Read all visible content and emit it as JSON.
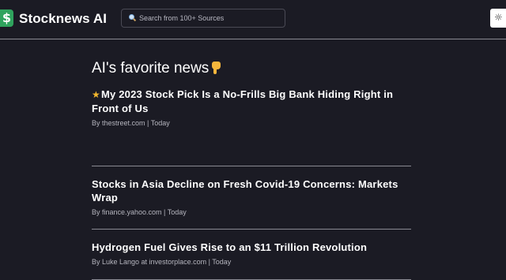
{
  "header": {
    "logo_symbol": "$",
    "brand": "Stocknews AI",
    "search": {
      "placeholder": "Search from 100+ Sources",
      "value": ""
    },
    "theme_toggle_icon": "sun-icon"
  },
  "main": {
    "section_title": "AI's favorite news",
    "section_icon": "pointing-down-icon",
    "news": [
      {
        "featured_icon": "star-icon",
        "title": "My 2023 Stock Pick Is a No-Frills Big Bank Hiding Right in Front of Us",
        "meta": "By thestreet.com | Today"
      },
      {
        "title": "Stocks in Asia Decline on Fresh Covid-19 Concerns: Markets Wrap",
        "meta": "By finance.yahoo.com | Today"
      },
      {
        "title": "Hydrogen Fuel Gives Rise to an $11 Trillion Revolution",
        "meta": "By Luke Lango at investorplace.com | Today"
      }
    ]
  },
  "colors": {
    "background": "#1b1b24",
    "logo_green": "#2fa35d",
    "star": "#f5b82e",
    "divider": "#8a8a92",
    "meta_text": "#b5b5be"
  }
}
